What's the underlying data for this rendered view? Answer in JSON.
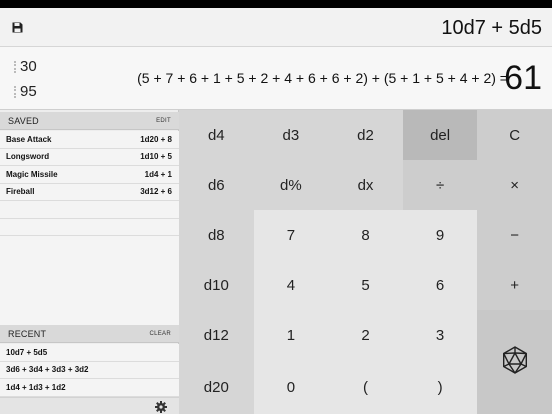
{
  "header": {
    "expression": "10d7 + 5d5"
  },
  "result": {
    "history": [
      "30",
      "95"
    ],
    "breakdown": "(5 + 7 + 6 + 1 + 5 + 2 + 4 + 6 + 6 + 2) + (5 + 1 + 5 + 4 + 2) =",
    "total": "61"
  },
  "saved": {
    "title": "SAVED",
    "action": "EDIT",
    "items": [
      {
        "name": "Base Attack",
        "formula": "1d20 + 8"
      },
      {
        "name": "Longsword",
        "formula": "1d10 + 5"
      },
      {
        "name": "Magic Missile",
        "formula": "1d4 + 1"
      },
      {
        "name": "Fireball",
        "formula": "3d12 + 6"
      }
    ]
  },
  "recent": {
    "title": "RECENT",
    "action": "CLEAR",
    "items": [
      "10d7 + 5d5",
      "3d6 + 3d4 + 3d3 + 3d2",
      "1d4 + 1d3 + 1d2"
    ]
  },
  "keys": {
    "d4": "d4",
    "d3": "d3",
    "d2": "d2",
    "del": "del",
    "clear": "C",
    "d6": "d6",
    "dpct": "d%",
    "dx": "dx",
    "divide": "÷",
    "multiply": "×",
    "d8": "d8",
    "n7": "7",
    "n8": "8",
    "n9": "9",
    "minus": "−",
    "d10": "d10",
    "n4": "4",
    "n5": "5",
    "n6": "6",
    "plus": "+",
    "d12": "d12",
    "n1": "1",
    "n2": "2",
    "n3": "3",
    "d20": "d20",
    "n0": "0",
    "lparen": "(",
    "rparen": ")"
  },
  "icons": {
    "save": "save-icon",
    "settings": "gear-icon",
    "roll": "d20-icon"
  }
}
